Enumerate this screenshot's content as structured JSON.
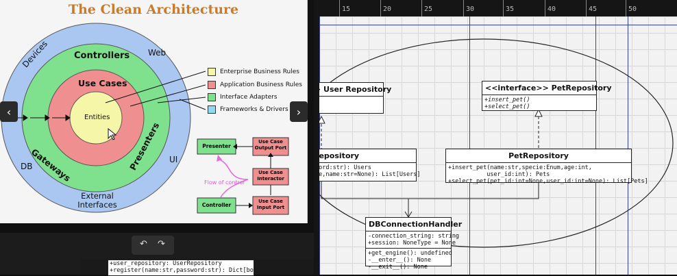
{
  "slide": {
    "title": "The Clean Architecture",
    "rings": {
      "devices": "Devices",
      "web": "Web",
      "db": "DB",
      "ui": "UI",
      "external": "External\nInterfaces",
      "controllers": "Controllers",
      "gateways": "Gateways",
      "presenters": "Presenters",
      "use_cases": "Use Cases",
      "entities": "Entities"
    },
    "legend": [
      {
        "label": "Enterprise Business Rules",
        "color": "#f6f6a8"
      },
      {
        "label": "Application Business Rules",
        "color": "#f08f8f"
      },
      {
        "label": "Interface Adapters",
        "color": "#7de38a"
      },
      {
        "label": "Frameworks & Drivers",
        "color": "#8fd9f2"
      }
    ],
    "flow": {
      "presenter": "Presenter",
      "output_port": "Use Case\nOutput Port",
      "interactor": "Use Case\nInteractor",
      "controller": "Controller",
      "input_port": "Use Case\nInput Port",
      "flow_label": "Flow of control"
    },
    "prev_icon": "chevron-left-icon",
    "next_icon": "chevron-right-icon"
  },
  "toolbar": {
    "undo_icon": "undo-icon",
    "redo_icon": "redo-icon"
  },
  "ruler": {
    "labels": [
      "15",
      "20",
      "25",
      "30",
      "35",
      "40",
      "45",
      "50"
    ]
  },
  "diagram": {
    "user_repo_interface": {
      "title": "> User Repository"
    },
    "pet_repo_interface": {
      "title": "<<interface>> PetRepository",
      "methods": [
        "+insert_pet()",
        "+select_pet()"
      ]
    },
    "user_repo_impl": {
      "title": "Repository",
      "methods": [
        "word:str): Users",
        "ne,name:str=None): List[Users]"
      ]
    },
    "pet_repo_impl": {
      "title": "PetRepository",
      "methods": [
        "+insert_pet(name:str,specie:Enum,age:int,",
        "           user_id:int): Pets",
        "+select_pet(pet_id:int=None,user_id:int=None): List[Pets]"
      ]
    },
    "db_handler": {
      "title": "DBConnectionHandler",
      "attributes": [
        "-connection_string: string",
        "+session: NoneType = None"
      ],
      "methods": [
        "+get_engine(): undefined",
        "-__enter__(): None",
        "-__exit__(): None"
      ]
    }
  },
  "code_fragment": {
    "lines": [
      "+user_repository: UserRepository",
      "+register(name:str,password:str): Dict[bool,"
    ]
  }
}
